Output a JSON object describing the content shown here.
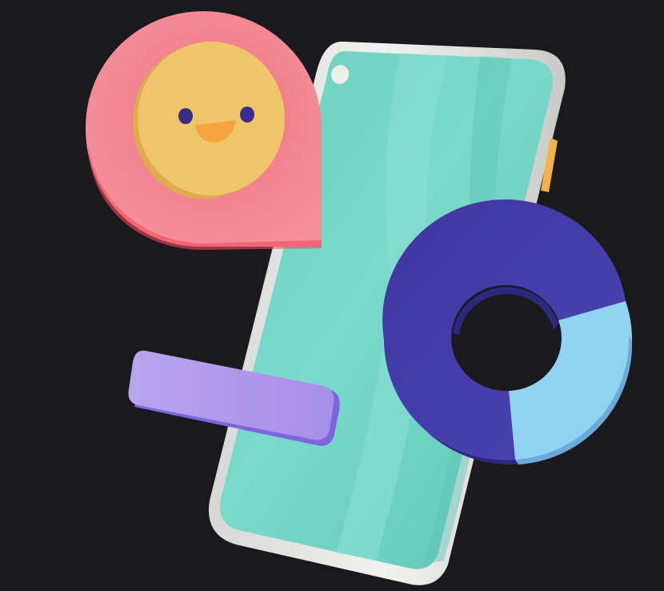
{
  "illustration": {
    "subject": "3d-phone-with-emoji-pin-bar-and-donut",
    "colors": {
      "background": "#1a191e",
      "phone_frame": "#e6e6e4",
      "phone_screen": "#74d4c6",
      "side_button": "#f2b24a",
      "pin": "#f28b95",
      "pin_shadow": "#f04b5c",
      "emoji_face": "#efc56a",
      "emoji_eye": "#3a2d8a",
      "emoji_mouth": "#f5a43f",
      "bar": "#b49cee",
      "bar_edge": "#7b66dd",
      "donut_dark": "#433aa5",
      "donut_light": "#8fd2f2"
    },
    "donut_segments": [
      {
        "name": "light-segment",
        "fraction": 0.33,
        "color": "#8fd2f2"
      },
      {
        "name": "dark-segment",
        "fraction": 0.67,
        "color": "#433aa5"
      }
    ]
  }
}
